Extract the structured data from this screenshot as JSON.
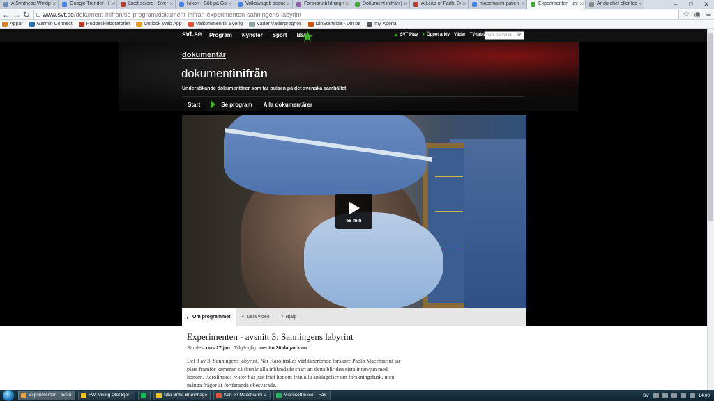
{
  "browser": {
    "tabs": [
      {
        "label": "A Synthetic Windpip",
        "color": "#6b8db5"
      },
      {
        "label": "Google Trender - Ind",
        "color": "#4285f4"
      },
      {
        "label": "Lixet.se/ord - Sveng",
        "color": "#c0392b"
      },
      {
        "label": "Nixon - Sök på Goo",
        "color": "#4285f4"
      },
      {
        "label": "Volkswageb scandal",
        "color": "#4285f4"
      },
      {
        "label": "Forskarutbildning vid",
        "color": "#9b59b6"
      },
      {
        "label": "Dokument inifrån | S",
        "color": "#3fae2a"
      },
      {
        "label": "A Leap of Faith: Dec",
        "color": "#c0392b"
      },
      {
        "label": "macchiarini patient",
        "color": "#4285f4"
      },
      {
        "label": "Experimenten - avsni",
        "color": "#3fae2a"
      },
      {
        "label": "Är du chef eller leda",
        "color": "#888888"
      }
    ],
    "active_tab": 9,
    "url_host": "www.svt.se",
    "url_path": "/dokument-inifran/se-program/dokument-inifran-experimenten-sanningens-labyrint",
    "bookmarks": [
      {
        "label": "Appar",
        "color": "#e67e22"
      },
      {
        "label": "Garmin Connect",
        "color": "#2a6fb0"
      },
      {
        "label": "Rudbecklaboratoriet",
        "color": "#c0392b"
      },
      {
        "label": "Outlook Web App",
        "color": "#f39c12"
      },
      {
        "label": "Välkommen till Sverig",
        "color": "#e74c3c"
      },
      {
        "label": "Väder Väderprognos",
        "color": "#95a5a6"
      },
      {
        "label": "DinStartsida - Din pe",
        "color": "#d35400"
      },
      {
        "label": "my Xperia",
        "color": "#555555"
      }
    ]
  },
  "svt": {
    "logo": "svt.se",
    "nav": [
      "Program",
      "Nyheter",
      "Sport",
      "Barn"
    ],
    "right_links": [
      "SVT Play",
      "Öppet arkiv",
      "Väder",
      "TV-tablå"
    ],
    "search_placeholder": "Sök på svt.se"
  },
  "brand": {
    "small": "dokumentär",
    "big_light": "dokument",
    "big_bold": "inifrån",
    "tagline": "Undersökande dokumentärer som tar pulsen på det svenska samhället"
  },
  "subnav": {
    "start": "Start",
    "se_program": "Se program",
    "alla": "Alla dokumentärer"
  },
  "video": {
    "duration": "58 min",
    "tabs": [
      "Om programmet",
      "Dela video",
      "Hjälp"
    ]
  },
  "episode": {
    "title": "Experimenten - avsnitt 3: Sanningens labyrint",
    "sands_label": "Sändes:",
    "sands_value": "ons 27 jan",
    "tillganglig_label": "Tillgänglig:",
    "tillganglig_value": "mer än 30 dagar kvar",
    "description": "Del 3 av 3: Sanningens labyrint. När Karolinskas världsberömde forskare Paolo Macchiarini tar plats framför kameran så förstår alla inblandade snart att detta blir den sista intervjun med honom. Karolinskas rektor har just friat honom från alla anklagelser om forskningsfusk, men många frågor är fortfarande obesvarade."
  },
  "taskbar": {
    "items": [
      {
        "label": "Experimenten - avsni",
        "color": "#e8a33c"
      },
      {
        "label": "FW: Viking Olof Björ",
        "color": "#f1c40f"
      },
      {
        "label": "",
        "color": "#1db954"
      },
      {
        "label": "Ulla-Britta Brunnhage",
        "color": "#f1c40f"
      },
      {
        "label": "Kan en Macchiarini u",
        "color": "#e74c3c"
      },
      {
        "label": "Microsoft Excel - Fak",
        "color": "#27ae60"
      }
    ],
    "lang": "SV",
    "clock": "14:00"
  }
}
